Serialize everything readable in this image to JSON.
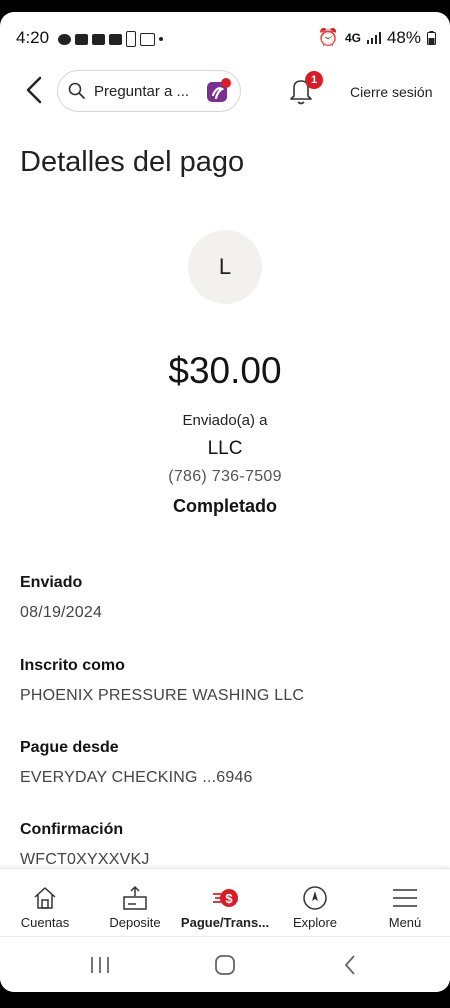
{
  "status_bar": {
    "time": "4:20",
    "network": "4G",
    "battery": "48%"
  },
  "header": {
    "search_placeholder": "Preguntar a ...",
    "notification_count": "1",
    "logout": "Cierre sesión"
  },
  "page": {
    "title": "Detalles del pago"
  },
  "payment": {
    "avatar_initial": "L",
    "amount": "$30.00",
    "sent_to_label": "Enviado(a) a",
    "recipient": "LLC",
    "phone": "(786) 736-7509",
    "status": "Completado"
  },
  "details": [
    {
      "label": "Enviado",
      "value": "08/19/2024"
    },
    {
      "label": "Inscrito como",
      "value": "PHOENIX PRESSURE WASHING LLC"
    },
    {
      "label": "Pague desde",
      "value": "EVERYDAY CHECKING ...6946"
    },
    {
      "label": "Confirmación",
      "value": "WFCT0XYXXVKJ"
    }
  ],
  "nav": [
    {
      "label": "Cuentas",
      "icon": "home-icon"
    },
    {
      "label": "Deposite",
      "icon": "deposit-icon"
    },
    {
      "label": "Pague/Trans...",
      "icon": "pay-transfer-icon"
    },
    {
      "label": "Explore",
      "icon": "compass-icon"
    },
    {
      "label": "Menú",
      "icon": "menu-icon"
    }
  ],
  "colors": {
    "accent_red": "#d71e28",
    "fargo_purple": "#7b2f8e"
  }
}
